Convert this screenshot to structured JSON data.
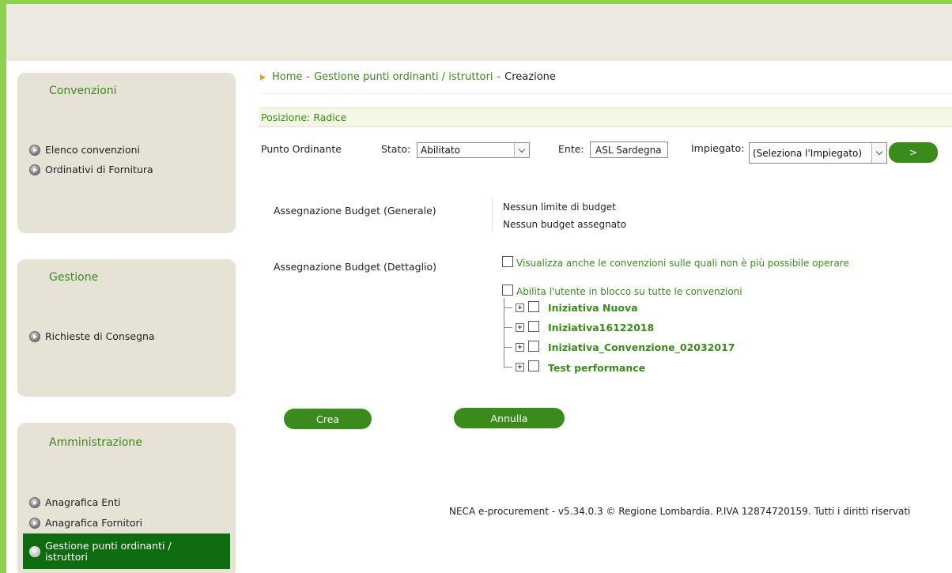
{
  "sidebar": {
    "convenzioni": {
      "title": "Convenzioni",
      "items": [
        "Elenco convenzioni",
        "Ordinativi di Fornitura"
      ]
    },
    "gestione": {
      "title": "Gestione",
      "items": [
        "Richieste di Consegna"
      ]
    },
    "amministrazione": {
      "title": "Amministrazione",
      "items": [
        "Anagrafica Enti",
        "Anagrafica Fornitori"
      ],
      "active_line1": "Gestione punti ordinanti /",
      "active_line2": "istruttori"
    }
  },
  "breadcrumb": {
    "home": "Home",
    "sep1": "-",
    "section": "Gestione punti ordinanti / istruttori",
    "sep2": "-",
    "current": "Creazione"
  },
  "position_bar": "Posizione: Radice",
  "form": {
    "punto_label": "Punto Ordinante",
    "stato_label": "Stato:",
    "stato_value": "Abilitato",
    "ente_label": "Ente:",
    "ente_value": "ASL Sardegna",
    "impiegato_label": "Impiegato:",
    "impiegato_value": "(Seleziona l'Impiegato)",
    "go_label": ">"
  },
  "budget_generale": {
    "label": "Assegnazione Budget (Generale)",
    "line1": "Nessun limite di budget",
    "line2": "Nessun budget assegnato"
  },
  "budget_dettaglio": {
    "label": "Assegnazione Budget (Dettaglio)",
    "show_all": "Visualizza anche le convenzioni sulle quali non è più possibile operare",
    "enable_all": "Abilita l'utente in blocco su tutte le convenzioni",
    "tree": [
      {
        "label": "Iniziativa Nuova"
      },
      {
        "label": "Iniziativa16122018"
      },
      {
        "label": "Iniziativa_Convenzione_02032017"
      },
      {
        "label": "Test performance"
      }
    ]
  },
  "actions": {
    "create": "Crea",
    "cancel": "Annulla"
  },
  "footer": "NECA e-procurement - v5.34.0.3 © Regione Lombardia. P.IVA 12874720159. Tutti i diritti riservati",
  "colors": {
    "accent_green": "#3b8a1c",
    "dark_green": "#0f6b10",
    "frame_green": "#8dd14e",
    "panel_bg": "#e6e2d6"
  }
}
